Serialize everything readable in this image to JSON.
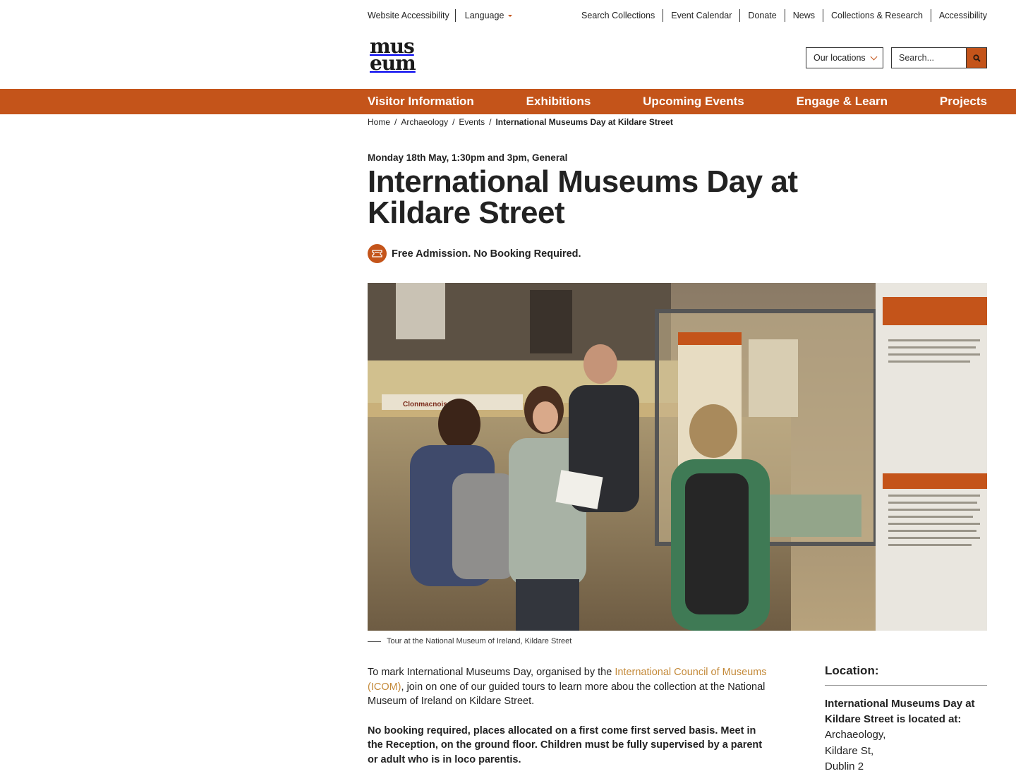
{
  "utility": {
    "left": [
      "Website Accessibility",
      "Language"
    ],
    "right": [
      "Search Collections",
      "Event Calendar",
      "Donate",
      "News",
      "Collections & Research",
      "Accessibility"
    ]
  },
  "logo": {
    "line1": "mus",
    "line2": "eum"
  },
  "header": {
    "locations_label": "Our locations",
    "search_placeholder": "Search..."
  },
  "nav": [
    "Visitor Information",
    "Exhibitions",
    "Upcoming Events",
    "Engage & Learn",
    "Projects"
  ],
  "breadcrumb": {
    "items": [
      "Home",
      "Archaeology",
      "Events"
    ],
    "separator": "/",
    "current": "International Museums Day at Kildare Street"
  },
  "event": {
    "meta": "Monday 18th May, 1:30pm and 3pm, General",
    "title": "International Museums Day at Kildare Street",
    "admission": "Free Admission. No Booking Required."
  },
  "hero": {
    "caption": "Tour at the National Museum of Ireland, Kildare Street",
    "sign_text": "Clonmacnoise Tarbh"
  },
  "body": {
    "p1_before": "To mark International Museums Day, organised by the ",
    "p1_link": "International Council of Museums (ICOM)",
    "p1_after": ", join on one of our guided tours to learn more abou the collection at the National Museum of Ireland on Kildare Street.",
    "p2": "No booking required, places allocated on a first come first served basis. Meet in the Reception, on the ground floor. Children must be fully supervised by a parent or adult who is in loco parentis."
  },
  "location": {
    "heading": "Location:",
    "intro": "International Museums Day at Kildare Street is located at:",
    "lines": [
      "Archaeology,",
      "Kildare St,",
      "Dublin 2"
    ]
  },
  "colors": {
    "accent": "#c4541a",
    "link": "#c48a3a",
    "text": "#222222"
  }
}
